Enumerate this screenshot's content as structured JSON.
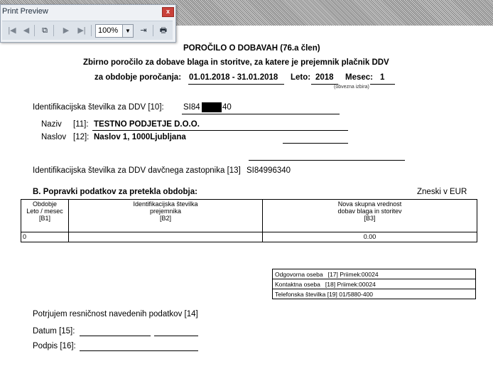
{
  "preview_window": {
    "title": "Print Preview",
    "zoom": "100%",
    "toolbar_icons": [
      "first-page-icon",
      "prev-page-icon",
      "copy-icon",
      "next-page-icon",
      "last-page-icon",
      "zoom-dropdown-icon",
      "exit-icon",
      "print-icon"
    ]
  },
  "report": {
    "title": "POROČILO O DOBAVAH (76.a člen)",
    "subtitle": "Zbirno poročilo za dobave blaga in storitve, za katere je prejemnik plačnik DDV",
    "period_label": "za obdobje poročanja:",
    "period_value": "01.01.2018 - 31.01.2018",
    "year_label": "Leto:",
    "year_value": "2018",
    "month_label": "Mesec:",
    "month_value": "1",
    "month_note": "(obvezna izbira)",
    "vat_id_label": "Identifikacijska številka za DDV [10]:",
    "vat_id_prefix": "SI84",
    "vat_id_suffix": "40",
    "name_label": "Naziv",
    "name_code": "[11]:",
    "name_value": "TESTNO PODJETJE D.O.O.",
    "address_label": "Naslov",
    "address_code": "[12]:",
    "address_value": "Naslov 1, 1000Ljubljana",
    "rep_vat_label": "Identifikacijska številka za DDV davčnega zastopnika [13]",
    "rep_vat_value": "SI84996340",
    "section_b": "B. Popravki podatkov za pretekla obdobja:",
    "currency_note": "Zneski v EUR"
  },
  "table_b": {
    "headers": [
      [
        "Obdobje",
        "Leto / mesec",
        "[B1]"
      ],
      [
        "Identifikacijska številka",
        "prejemnika",
        "[B2]"
      ],
      [
        "Nova skupna vrednost",
        "dobav blaga in storitev",
        "[B3]"
      ]
    ],
    "rows": [
      [
        "0",
        "",
        "0.00"
      ]
    ]
  },
  "contacts": [
    {
      "label": "Odgovorna oseba",
      "code": "[17]",
      "value": "Priimek:00024"
    },
    {
      "label": "Kontaktna oseba",
      "code": "[18]",
      "value": "Priimek:00024"
    },
    {
      "label": "Telefonska številka",
      "code": "[19]",
      "value": "01/5880-400"
    }
  ],
  "footer": {
    "confirm": "Potrjujem resničnost navedenih podatkov [14]",
    "date_label": "Datum [15]:",
    "sign_label": "Podpis [16]:"
  }
}
